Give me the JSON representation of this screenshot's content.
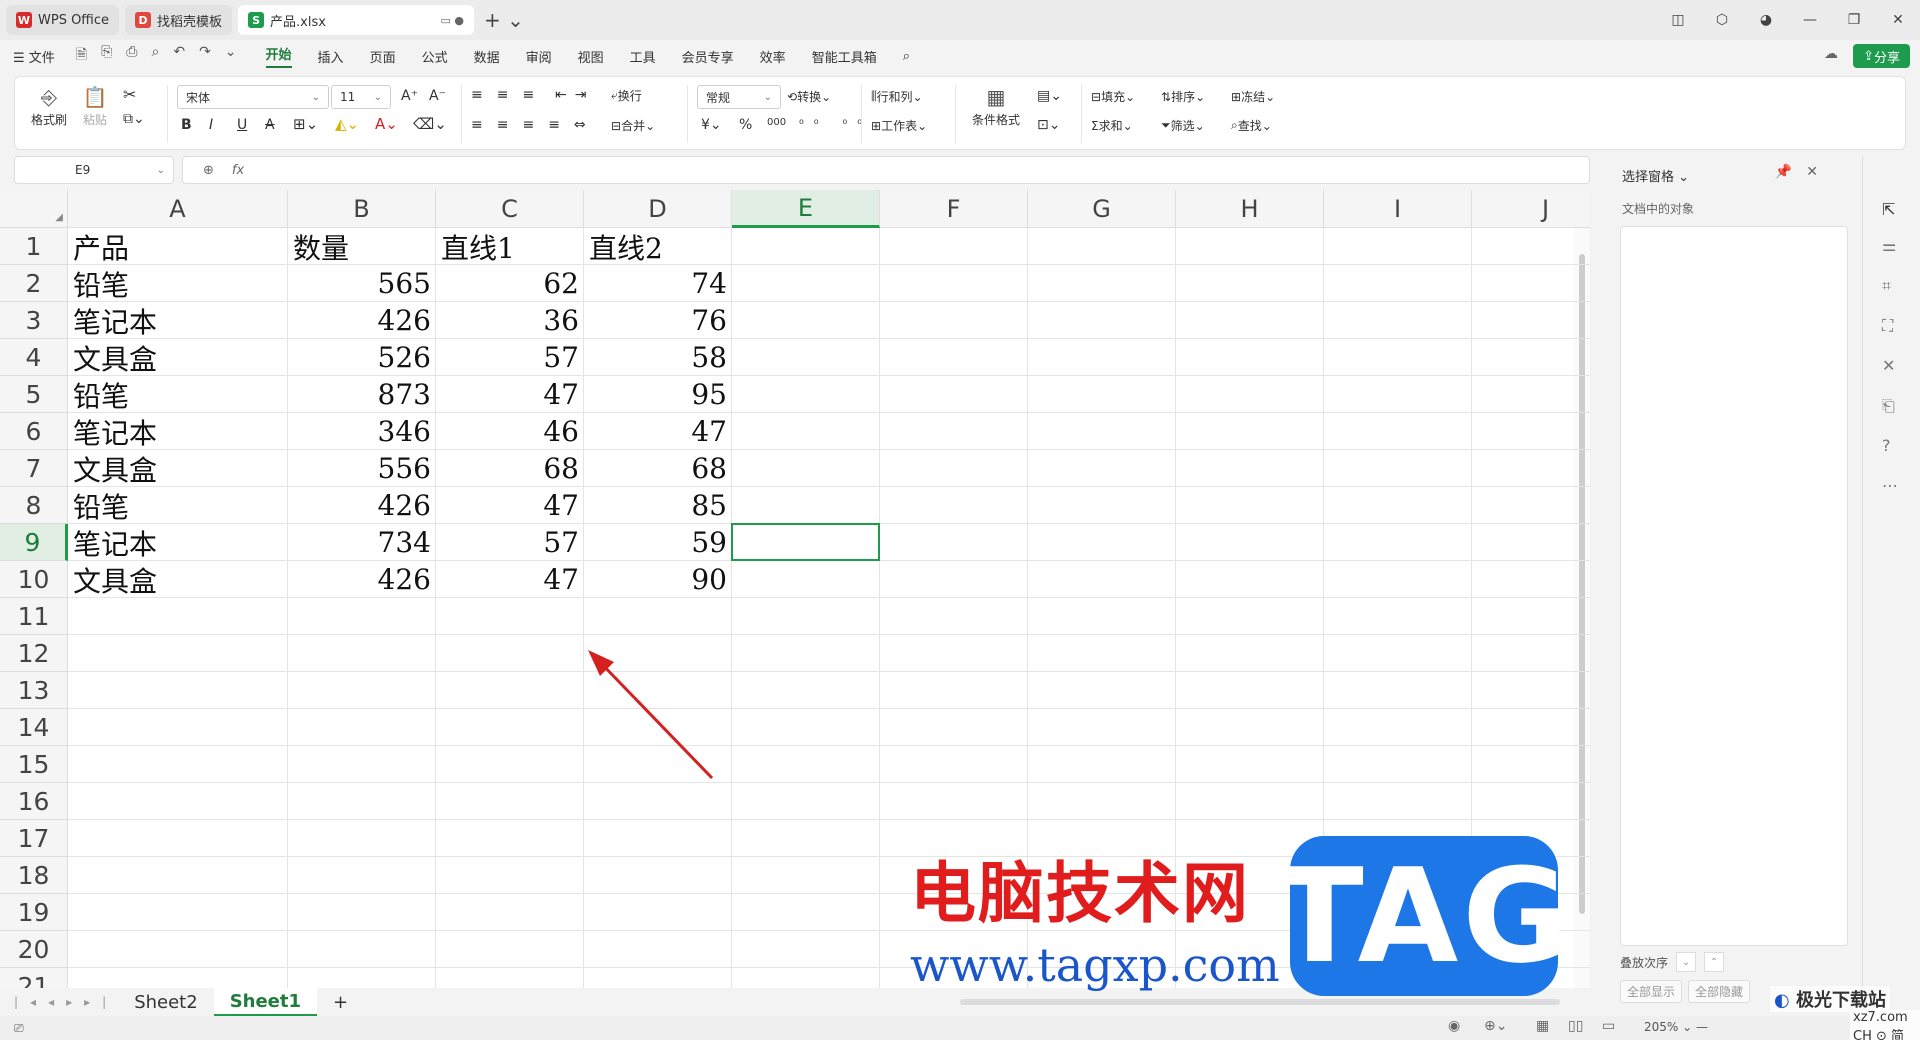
{
  "titlebar": {
    "tabs": [
      {
        "label": "WPS Office",
        "icon": "wps-logo",
        "color": "#d72a2a"
      },
      {
        "label": "找稻壳模板",
        "icon": "docer-logo",
        "color": "#e0473e"
      },
      {
        "label": "产品.xlsx",
        "icon": "spreadsheet-logo",
        "color": "#1e9b4c"
      }
    ]
  },
  "menu": {
    "file": "文件",
    "items": [
      "开始",
      "插入",
      "页面",
      "公式",
      "数据",
      "审阅",
      "视图",
      "工具",
      "会员专享",
      "效率",
      "智能工具箱"
    ],
    "active": "开始",
    "share": "分享"
  },
  "ribbon": {
    "format_painter": "格式刷",
    "paste": "粘贴",
    "font_name": "宋体",
    "font_size": "11",
    "wrap": "换行",
    "merge": "合并",
    "number_format": "常规",
    "convert": "转换",
    "row_col": "行和列",
    "worksheet": "工作表",
    "cond_format": "条件格式",
    "fill": "填充",
    "sort": "排序",
    "freeze": "冻结",
    "sum": "求和",
    "filter": "筛选",
    "find": "查找",
    "bold": "B",
    "italic": "I",
    "underline": "U",
    "strike": "A",
    "percent": "%",
    "currency": "¥",
    "thousands": "000"
  },
  "formula_bar": {
    "cell_ref": "E9",
    "fx": "fx",
    "value": ""
  },
  "grid": {
    "columns": [
      "A",
      "B",
      "C",
      "D",
      "E",
      "F",
      "G",
      "H",
      "I",
      "J"
    ],
    "selected_column": "E",
    "rows": [
      "1",
      "2",
      "3",
      "4",
      "5",
      "6",
      "7",
      "8",
      "9",
      "10",
      "11",
      "12",
      "13",
      "14",
      "15",
      "16",
      "17",
      "18",
      "19",
      "20",
      "21"
    ],
    "selected_row": "9",
    "header": [
      "产品",
      "数量",
      "直线1",
      "直线2"
    ],
    "data": [
      [
        "铅笔",
        "565",
        "62",
        "74"
      ],
      [
        "笔记本",
        "426",
        "36",
        "76"
      ],
      [
        "文具盒",
        "526",
        "57",
        "58"
      ],
      [
        "铅笔",
        "873",
        "47",
        "95"
      ],
      [
        "笔记本",
        "346",
        "46",
        "47"
      ],
      [
        "文具盒",
        "556",
        "68",
        "68"
      ],
      [
        "铅笔",
        "426",
        "47",
        "85"
      ],
      [
        "笔记本",
        "734",
        "57",
        "59"
      ],
      [
        "文具盒",
        "426",
        "47",
        "90"
      ]
    ]
  },
  "sheets": {
    "tabs": [
      "Sheet2",
      "Sheet1"
    ],
    "active": "Sheet1",
    "add": "+"
  },
  "status": {
    "zoom": "205%"
  },
  "selection_pane": {
    "title": "选择窗格",
    "subtitle": "文档中的对象",
    "order_label": "叠放次序",
    "show_all": "全部显示",
    "hide_all": "全部隐藏"
  },
  "watermark": {
    "cn": "电脑技术网",
    "url": "www.tagxp.com",
    "tag": "TAG",
    "site2": "极光下载站",
    "site2_url": "xz7.com",
    "ime": "CH ⊙ 简"
  },
  "annotation": {
    "arrow_color": "#d42020"
  }
}
